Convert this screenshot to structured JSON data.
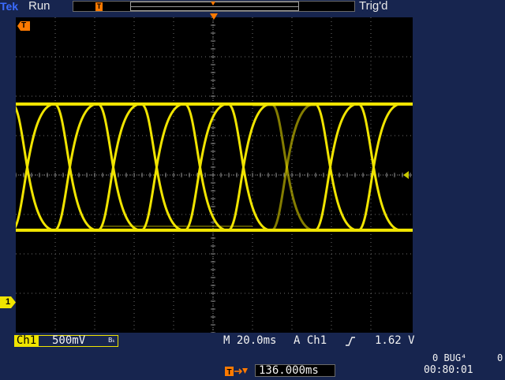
{
  "header": {
    "brand": "Tek",
    "run_status": "Run",
    "trigger_status": "Trig'd",
    "trigger_marker_label": "T"
  },
  "screen": {
    "trigger_marker_label": "T",
    "channel_marker_label": "1"
  },
  "status_bar": {
    "channel_label": "Ch1",
    "volts_per_div": "500mV",
    "bw_limit_icon": "Bₖ",
    "timebase": "M 20.0ms",
    "trigger_mode": "A",
    "trigger_channel": "Ch1",
    "trigger_slope_icon": "∫",
    "trigger_level": "1.62 V"
  },
  "lower_info": {
    "counter_text": "0 BUG⁴",
    "counter_text_2": "0",
    "clock": "00:80:01",
    "delay_value": "136.000ms"
  },
  "colors": {
    "trace": "#f0e400",
    "trigger": "#ff7a00",
    "background": "#17254f"
  },
  "waveform": {
    "type": "eye-diagram",
    "high_level_div": 1.8,
    "low_level_div": -1.4,
    "note_levels": "approximate vertical divisions relative to center"
  }
}
